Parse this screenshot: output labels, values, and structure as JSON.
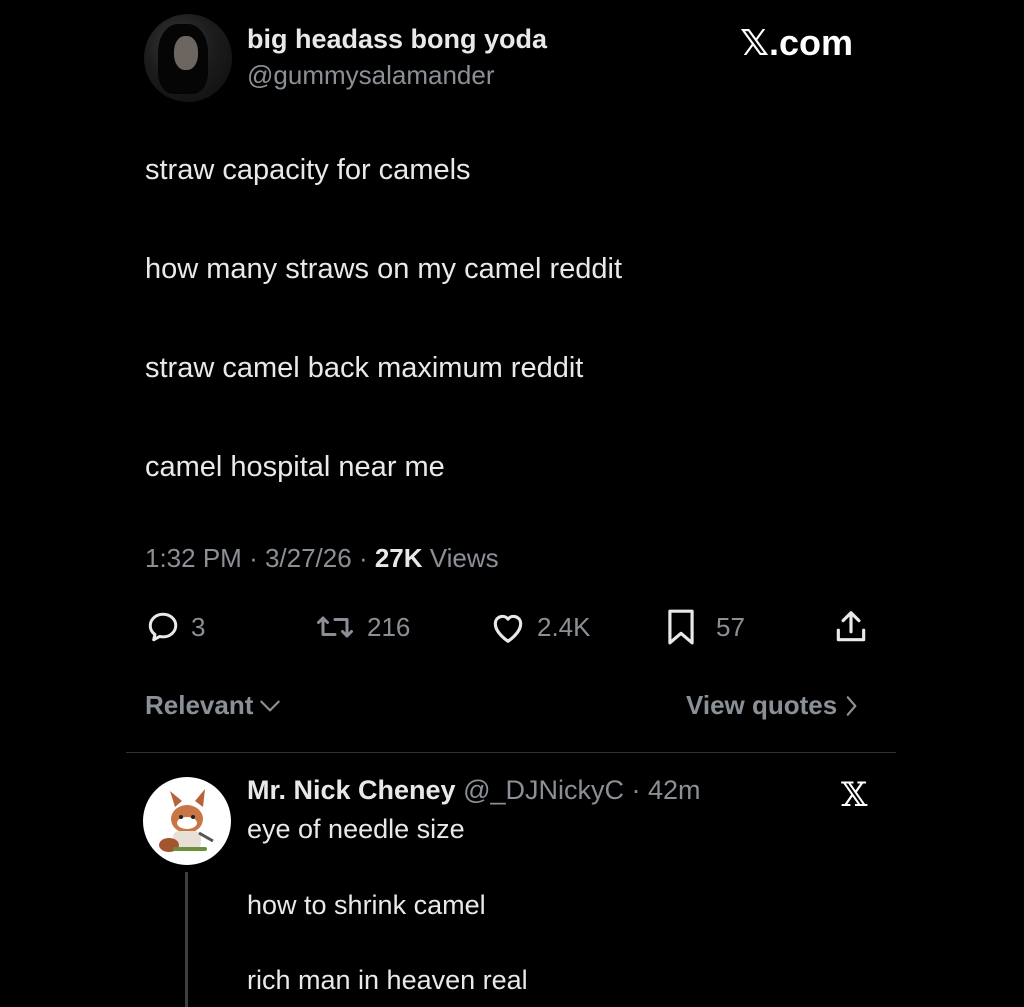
{
  "author": {
    "display_name": "big headass bong yoda",
    "handle": "@gummysalamander"
  },
  "brand": "𝕏.com",
  "post_lines": [
    "straw capacity for camels",
    "how many straws on my camel reddit",
    "straw camel back maximum reddit",
    "camel hospital near me"
  ],
  "meta": {
    "time": "1:32 PM",
    "date": "3/27/26",
    "views_count": "27K",
    "views_label": "Views",
    "sep": "·"
  },
  "actions": {
    "replies": "3",
    "reposts": "216",
    "likes": "2.4K",
    "bookmarks": "57"
  },
  "sort_label": "Relevant",
  "view_quotes_label": "View quotes",
  "reply": {
    "display_name": "Mr. Nick Cheney",
    "handle": "@_DJNickyC",
    "time": "42m",
    "badge": "𝕏",
    "lines": [
      "eye of needle size",
      "how to shrink camel",
      "rich man in heaven real"
    ]
  },
  "colors": {
    "background": "#000000",
    "text": "#e7e9ea",
    "muted": "#8b9096",
    "divider": "#2f3336"
  },
  "icons": [
    "reply-icon",
    "repost-icon",
    "like-icon",
    "bookmark-icon",
    "share-icon",
    "chevron-down-icon",
    "chevron-right-icon"
  ]
}
